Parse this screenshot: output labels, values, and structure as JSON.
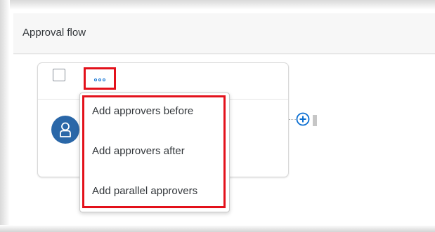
{
  "header": {
    "title": "Approval flow"
  },
  "card": {
    "more_icon": "more-horizontal-icon",
    "avatar_icon": "person-icon"
  },
  "menu": {
    "items": [
      {
        "label": "Add approvers before"
      },
      {
        "label": "Add approvers after"
      },
      {
        "label": "Add parallel approvers"
      }
    ]
  },
  "add_icon": "add-circle-icon",
  "colors": {
    "accent": "#0a6ed1",
    "highlight": "#e3111b",
    "avatar": "#2a67a8",
    "text": "#32363a"
  }
}
